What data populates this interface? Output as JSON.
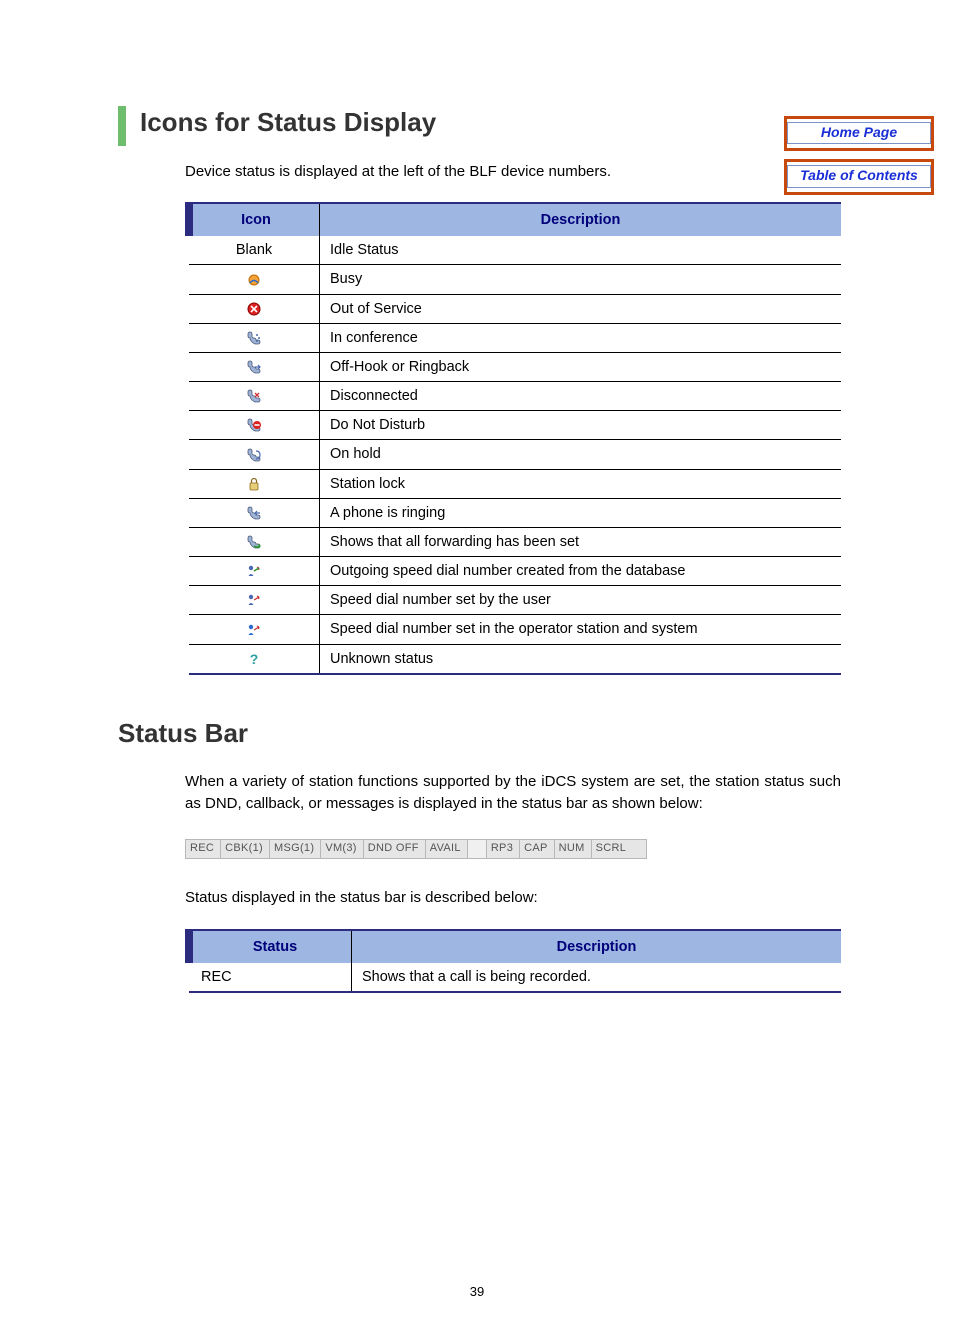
{
  "nav": {
    "home": "Home Page",
    "toc": "Table of Contents"
  },
  "section1": {
    "heading": "Icons for Status Display",
    "intro": "Device status is displayed at the left of the BLF device numbers.",
    "table": {
      "head_icon": "Icon",
      "head_desc": "Description",
      "rows": [
        {
          "icon_label": "Blank",
          "icon_kind": "text",
          "desc": "Idle Status"
        },
        {
          "icon_label": "",
          "icon_kind": "busy",
          "desc": "Busy"
        },
        {
          "icon_label": "",
          "icon_kind": "oos",
          "desc": "Out of Service"
        },
        {
          "icon_label": "",
          "icon_kind": "conf",
          "desc": "In conference"
        },
        {
          "icon_label": "",
          "icon_kind": "offhook",
          "desc": "Off-Hook or Ringback"
        },
        {
          "icon_label": "",
          "icon_kind": "disc",
          "desc": "Disconnected"
        },
        {
          "icon_label": "",
          "icon_kind": "dnd",
          "desc": "Do Not Disturb"
        },
        {
          "icon_label": "",
          "icon_kind": "hold",
          "desc": "On hold"
        },
        {
          "icon_label": "",
          "icon_kind": "lock",
          "desc": "Station lock"
        },
        {
          "icon_label": "",
          "icon_kind": "ring",
          "desc": "A phone is ringing"
        },
        {
          "icon_label": "",
          "icon_kind": "fwdall",
          "desc": "Shows that all forwarding has been set"
        },
        {
          "icon_label": "",
          "icon_kind": "sd_db",
          "desc": "Outgoing speed dial number created from the database"
        },
        {
          "icon_label": "",
          "icon_kind": "sd_user",
          "desc": "Speed dial number set by the user"
        },
        {
          "icon_label": "",
          "icon_kind": "sd_op",
          "desc": "Speed dial number set in the operator station and system"
        },
        {
          "icon_label": "",
          "icon_kind": "unknown",
          "desc": "Unknown status"
        }
      ]
    }
  },
  "section2": {
    "heading": "Status Bar",
    "intro": "When a variety of station functions supported by the iDCS system are set, the station status such as DND, callback, or messages is displayed in the status bar as shown below:",
    "strip": [
      "REC",
      "CBK(1)",
      "MSG(1)",
      "VM(3)",
      "DND OFF",
      "AVAIL",
      "",
      "RP3",
      "CAP",
      "NUM",
      "SCRL"
    ],
    "after_strip": "Status displayed in the status bar is described below:",
    "table": {
      "head_status": "Status",
      "head_desc": "Description",
      "rows": [
        {
          "status": "REC",
          "desc": "Shows that a call is being recorded."
        }
      ]
    }
  },
  "page_number": "39"
}
